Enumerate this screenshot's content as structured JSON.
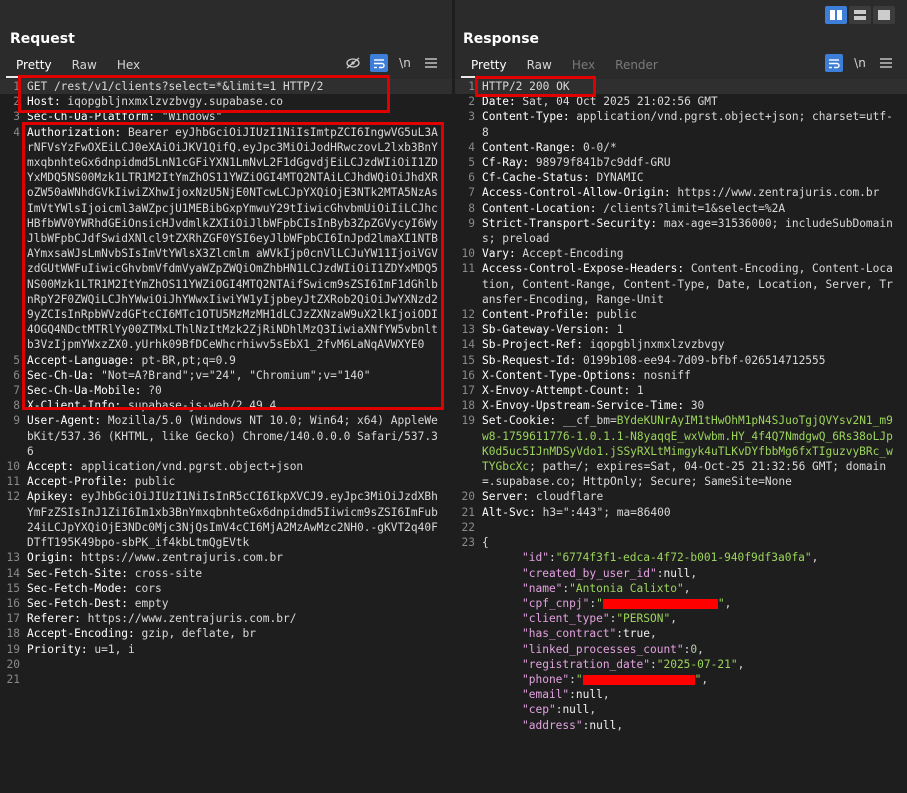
{
  "layout_buttons": [
    "split-horizontal-icon",
    "split-vertical-icon",
    "single-pane-icon"
  ],
  "request": {
    "title": "Request",
    "tabs": [
      {
        "label": "Pretty",
        "active": true
      },
      {
        "label": "Raw",
        "active": false
      },
      {
        "label": "Hex",
        "active": false
      }
    ],
    "lines": [
      {
        "n": "1",
        "key": "",
        "text": "GET /rest/v1/clients?select=*&limit=1 HTTP/2"
      },
      {
        "n": "2",
        "key": "Host:",
        "text": " iqopgbljnxmxlzvzbvgy.supabase.co"
      },
      {
        "n": "3",
        "key": "Sec-Ch-Ua-Platform:",
        "text": " \"Windows\""
      },
      {
        "n": "4",
        "key": "Authorization:",
        "text": " Bearer eyJhbGciOiJIUzI1NiIsImtpZCI6IngwVG5uL3ArNFVsYzFwOXEiLCJ0eXAiOiJKV1QifQ.eyJpc3MiOiJodHRwczovL2lxb3BnYmxqbnhteGx6dnpidmd5LnN1cGFiYXN1LmNvL2F1dGgvdjEiLCJzdWIiOiI1ZDYxMDQ5NS00Mzk1LTR1M2ItYmZhOS11YWZiOGI4MTQ2NTAiLCJhdWQiOiJhdXRoZW50aWNhdGVkIiwiZXhwIjoxNzU5NjE0NTcwLCJpYXQiOjE3NTk2MTA5NzAsImVtYWlsIjoicml3aWZpcjU1MEBibGxpYmwuY29tIiwicGhvbmUiOiIiLCJhcHBfbWV0YWRhdGEiOnsicHJvdmlkZXIiOiJlbWFpbCIsInByb3ZpZGVycyI6WyJlbWFpbCJdfSwidXNlcl9tZXRhZGF0YSI6eyJlbWFpbCI6InJpd2lmaXI1NTBAYmxsaWJsLmNvbSIsImVtYWlsX3Zlcmlm aWVkIjp0cnVlLCJuYW11IjoiVGVzdGUtWWFuIiwicGhvbmVfdmVyaWZpZWQiOmZhbHN1LCJzdWIiOiI1ZDYxMDQ5NS00Mzk1LTR1M2ItYmZhOS11YWZiOGI4MTQ2NTAifSwicm9sZSI6ImF1dGhlbnRpY2F0ZWQiLCJhYWwiOiJhYWwxIiwiYW1yIjpbeyJtZXRob2QiOiJwYXNzd29yZCIsInRpbWVzdGFtcCI6MTc1OTU5MzMzMH1dLCJzZXNzaW9uX2lkIjoiODI4OGQ4NDctMTRlYy00ZTMxLThlNzItMzk2ZjRiNDhlMzQ3IiwiaXNfYW5vbnltb3VzIjpmYWxzZX0.yUrhk09BfDCeWhcrhiwv5sEbX1_2fvM6LaNqAVWXYE0"
      },
      {
        "n": "5",
        "key": "Accept-Language:",
        "text": " pt-BR,pt;q=0.9"
      },
      {
        "n": "6",
        "key": "Sec-Ch-Ua:",
        "text": " \"Not=A?Brand\";v=\"24\", \"Chromium\";v=\"140\""
      },
      {
        "n": "7",
        "key": "Sec-Ch-Ua-Mobile:",
        "text": " ?0"
      },
      {
        "n": "8",
        "key": "X-Client-Info:",
        "text": " supabase-js-web/2.49.4"
      },
      {
        "n": "9",
        "key": "User-Agent:",
        "text": " Mozilla/5.0 (Windows NT 10.0; Win64; x64) AppleWebKit/537.36 (KHTML, like Gecko) Chrome/140.0.0.0 Safari/537.36"
      },
      {
        "n": "10",
        "key": "Accept:",
        "text": " application/vnd.pgrst.object+json"
      },
      {
        "n": "11",
        "key": "Accept-Profile:",
        "text": " public"
      },
      {
        "n": "12",
        "key": "Apikey:",
        "text": " eyJhbGciOiJIUzI1NiIsInR5cCI6IkpXVCJ9.eyJpc3MiOiJzdXBhYmFzZSIsInJ1ZiI6Im1xb3BnYmxqbnhteGx6dnpidmd5Iiwicm9sZSI6ImFub24iLCJpYXQiOjE3NDc0Mjc3NjQsImV4cCI6MjA2MzAwMzc2NH0.-gKVT2q40FDTfT195K49bpo-sbPK_if4kbLtmQgEVtk"
      },
      {
        "n": "13",
        "key": "Origin:",
        "text": " https://www.zentrajuris.com.br"
      },
      {
        "n": "14",
        "key": "Sec-Fetch-Site:",
        "text": " cross-site"
      },
      {
        "n": "15",
        "key": "Sec-Fetch-Mode:",
        "text": " cors"
      },
      {
        "n": "16",
        "key": "Sec-Fetch-Dest:",
        "text": " empty"
      },
      {
        "n": "17",
        "key": "Referer:",
        "text": " https://www.zentrajuris.com.br/"
      },
      {
        "n": "18",
        "key": "Accept-Encoding:",
        "text": " gzip, deflate, br"
      },
      {
        "n": "19",
        "key": "Priority:",
        "text": " u=1, i"
      },
      {
        "n": "20",
        "key": "",
        "text": ""
      },
      {
        "n": "21",
        "key": "",
        "text": ""
      }
    ]
  },
  "response": {
    "title": "Response",
    "tabs": [
      {
        "label": "Pretty",
        "active": true
      },
      {
        "label": "Raw",
        "active": false
      },
      {
        "label": "Hex",
        "active": false,
        "disabled": true
      },
      {
        "label": "Render",
        "active": false,
        "disabled": true
      }
    ],
    "lines": [
      {
        "n": "1",
        "key": "",
        "text": "HTTP/2 200 OK"
      },
      {
        "n": "2",
        "key": "Date:",
        "text": " Sat, 04 Oct 2025 21:02:56 GMT"
      },
      {
        "n": "3",
        "key": "Content-Type:",
        "text": " application/vnd.pgrst.object+json; charset=utf-8"
      },
      {
        "n": "4",
        "key": "Content-Range:",
        "text": " 0-0/*"
      },
      {
        "n": "5",
        "key": "Cf-Ray:",
        "text": " 98979f841b7c9ddf-GRU"
      },
      {
        "n": "6",
        "key": "Cf-Cache-Status:",
        "text": " DYNAMIC"
      },
      {
        "n": "7",
        "key": "Access-Control-Allow-Origin:",
        "text": " https://www.zentrajuris.com.br"
      },
      {
        "n": "8",
        "key": "Content-Location:",
        "text": " /clients?limit=1&select=%2A"
      },
      {
        "n": "9",
        "key": "Strict-Transport-Security:",
        "text": " max-age=31536000; includeSubDomains; preload"
      },
      {
        "n": "10",
        "key": "Vary:",
        "text": " Accept-Encoding"
      },
      {
        "n": "11",
        "key": "Access-Control-Expose-Headers:",
        "text": " Content-Encoding, Content-Location, Content-Range, Content-Type, Date, Location, Server, Transfer-Encoding, Range-Unit"
      },
      {
        "n": "12",
        "key": "Content-Profile:",
        "text": " public"
      },
      {
        "n": "13",
        "key": "Sb-Gateway-Version:",
        "text": " 1"
      },
      {
        "n": "14",
        "key": "Sb-Project-Ref:",
        "text": " iqopgbljnxmxlzvzbvgy"
      },
      {
        "n": "15",
        "key": "Sb-Request-Id:",
        "text": " 0199b108-ee94-7d09-bfbf-026514712555"
      },
      {
        "n": "16",
        "key": "X-Content-Type-Options:",
        "text": " nosniff"
      },
      {
        "n": "17",
        "key": "X-Envoy-Attempt-Count:",
        "text": " 1"
      },
      {
        "n": "18",
        "key": "X-Envoy-Upstream-Service-Time:",
        "text": " 30"
      },
      {
        "n": "19",
        "key": "Set-Cookie:",
        "text": " __cf_bm=",
        "cookie": "BYdeKUNrAyIM1tHwOhM1pN4SJuoTgjQVYsv2N1_m9w8-1759611776-1.0.1.1-N8yaqqE_wxVwbm.HY_4f4Q7NmdgwQ_6Rs38oLJpK0d5uc5IJnMDSyVdo1.jSSyRXLtMimgyk4uTLKvDYfbbMg6fxTIguzvyBRc_wTYGbcXc",
        "after": "; path=/; expires=Sat, 04-Oct-25 21:32:56 GMT; domain=.supabase.co; HttpOnly; Secure; SameSite=None"
      },
      {
        "n": "20",
        "key": "Server:",
        "text": " cloudflare"
      },
      {
        "n": "21",
        "key": "Alt-Svc:",
        "text": " h3=\":443\"; ma=86400"
      },
      {
        "n": "22",
        "key": "",
        "text": ""
      },
      {
        "n": "23",
        "key": "",
        "text": "{"
      }
    ],
    "json": [
      {
        "k": "\"id\"",
        "v": "\"6774f3f1-edca-4f72-b001-940f9df3a0fa\"",
        "type": "str"
      },
      {
        "k": "\"created_by_user_id\"",
        "v": "null",
        "type": "kw"
      },
      {
        "k": "\"name\"",
        "v": "\"Antonia Calixto\"",
        "type": "str"
      },
      {
        "k": "\"cpf_cnpj\"",
        "v": "REDACTED",
        "type": "redact",
        "w": 115
      },
      {
        "k": "\"client_type\"",
        "v": "\"PERSON\"",
        "type": "str"
      },
      {
        "k": "\"has_contract\"",
        "v": "true",
        "type": "kw"
      },
      {
        "k": "\"linked_processes_count\"",
        "v": "0",
        "type": "num"
      },
      {
        "k": "\"registration_date\"",
        "v": "\"2025-07-21\"",
        "type": "str"
      },
      {
        "k": "\"phone\"",
        "v": "REDACTED",
        "type": "redact",
        "w": 112
      },
      {
        "k": "\"email\"",
        "v": "null",
        "type": "kw"
      },
      {
        "k": "\"cep\"",
        "v": "null",
        "type": "kw"
      },
      {
        "k": "\"address\"",
        "v": "null",
        "type": "kw"
      }
    ]
  }
}
